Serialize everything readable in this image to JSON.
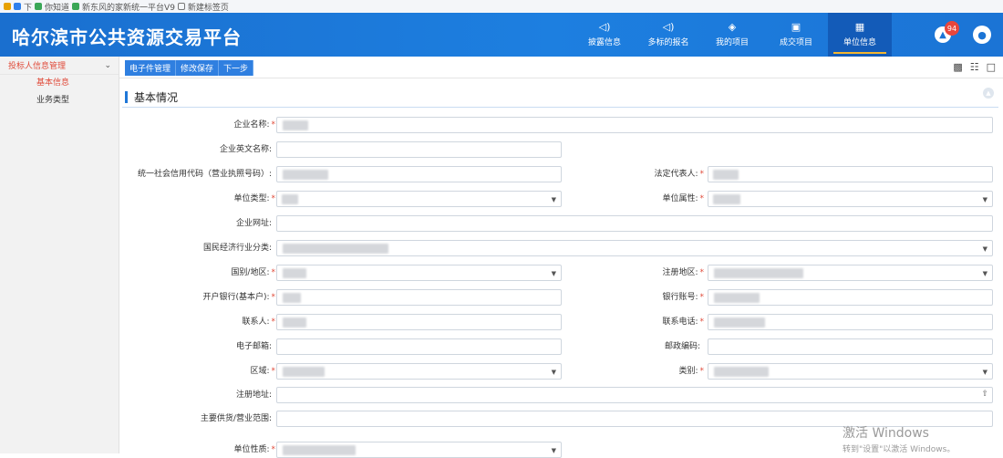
{
  "bookmarks": [
    "下",
    "你知道",
    "新东风的家新统一平台V9",
    "新建标签页"
  ],
  "header": {
    "brand": "哈尔滨市公共资源交易平台",
    "nav": [
      {
        "label": "披露信息",
        "icon": "speaker-icon"
      },
      {
        "label": "多标的报名",
        "icon": "speaker-icon"
      },
      {
        "label": "我的项目",
        "icon": "layers-icon"
      },
      {
        "label": "成交项目",
        "icon": "folder-icon"
      },
      {
        "label": "单位信息",
        "icon": "building-icon",
        "active": true
      }
    ],
    "badge_count": "94"
  },
  "sidebar": {
    "group": "投标人信息管理",
    "items": [
      {
        "label": "基本信息",
        "active": true
      },
      {
        "label": "业务类型",
        "active": false
      }
    ]
  },
  "toolbar": {
    "buttons": [
      "电子件管理",
      "修改保存",
      "下一步"
    ]
  },
  "section": {
    "title": "基本情况"
  },
  "form": {
    "company_name": "企业名称:",
    "company_en_name": "企业英文名称:",
    "credit_code": "统一社会信用代码（营业执照号码）:",
    "legal_rep": "法定代表人:",
    "unit_type": "单位类型:",
    "unit_attr": "单位属性:",
    "website": "企业网址:",
    "industry": "国民经济行业分类:",
    "country": "国别/地区:",
    "reg_region": "注册地区:",
    "bank": "开户银行(基本户):",
    "bank_account": "银行账号:",
    "contact": "联系人:",
    "contact_phone": "联系电话:",
    "email": "电子邮箱:",
    "postcode": "邮政编码:",
    "area": "区域:",
    "category": "类别:",
    "reg_address": "注册地址:",
    "scope": "主要供货/营业范围:",
    "unit_nature": "单位性质:"
  },
  "watermark": {
    "line1": "激活 Windows",
    "line2": "转到\"设置\"以激活 Windows。"
  }
}
